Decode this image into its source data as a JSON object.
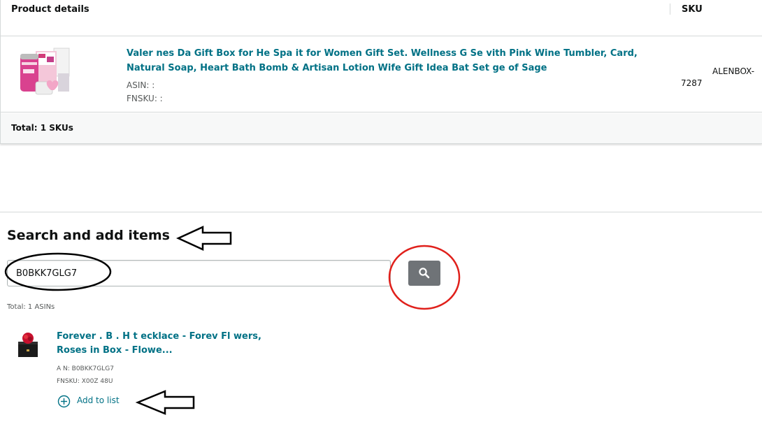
{
  "product_table": {
    "header": {
      "product_col": "Product details",
      "sku_col": "SKU"
    },
    "row": {
      "title": "Valer  nes Da  Gift Box for He   Spa  it for Women Gift Set. Wellness G   Se   vith Pink Wine Tumbler, Card, Natural Soap, Heart Bath Bomb & Artisan Lotion    Wife Gift Idea Bat  Set    ge of Sage",
      "asin_label": "ASIN: :",
      "fnsku_label": "FNSKU: :",
      "sku_line1": "ALENBOX-",
      "sku_line2": "7287"
    },
    "footer": {
      "total": "Total: 1 SKUs"
    }
  },
  "search": {
    "heading": "Search and add items",
    "input_value": "B0BKK7GLG7",
    "results_total": "Total: 1 ASINs",
    "result": {
      "title": "Forever   .    B     .  H    t   ecklace - Forev   Fl   wers, Roses in   Box - Flowe...",
      "asin_label": "A   N: B0BKK7GLG7",
      "fnsku_label": "FNSKU: X00Z  48U  ",
      "add_label": "Add to list"
    }
  },
  "colors": {
    "link": "#007185",
    "search_button": "#6f7377",
    "annotation_circle": "#e0201b",
    "border": "#d5d9d9"
  }
}
